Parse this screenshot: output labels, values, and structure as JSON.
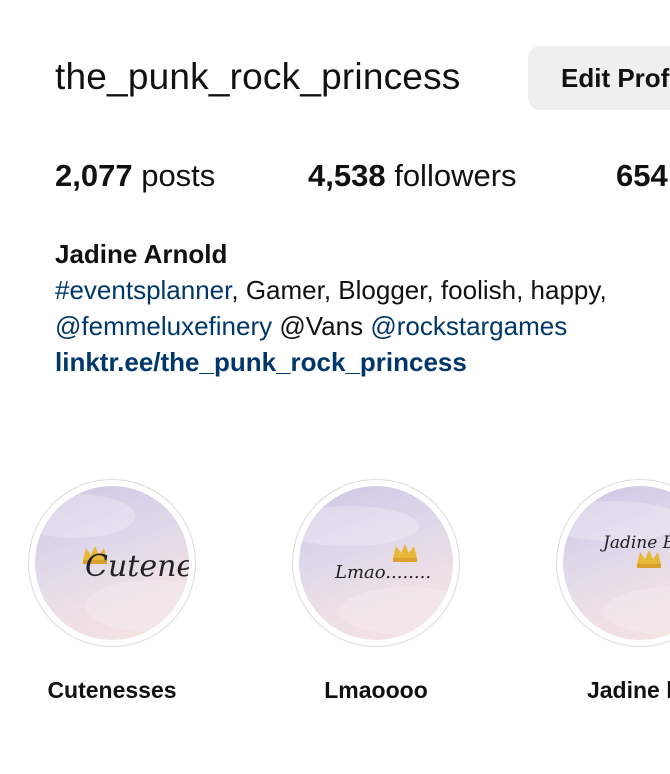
{
  "profile": {
    "username": "the_punk_rock_princess",
    "edit_button": "Edit Profile"
  },
  "stats": {
    "posts_count": "2,077",
    "posts_label": "posts",
    "followers_count": "4,538",
    "followers_label": "followers",
    "following_count": "654"
  },
  "bio": {
    "full_name": "Jadine Arnold",
    "hashtag": "#eventsplanner",
    "line1_text": ", Gamer, Blogger, foolish, happy,",
    "mention1": "@femmeluxefinery",
    "mention2_text": " @Vans ",
    "mention3": "@rockstargames",
    "link": "linktr.ee/the_punk_rock_princess"
  },
  "highlights": [
    {
      "label": "Cutenesses",
      "cover_text": "Cuteness"
    },
    {
      "label": "Lmaoooo",
      "cover_text": "Lmao........"
    },
    {
      "label": "Jadine be",
      "cover_text": "Jadine Being......"
    }
  ],
  "colors": {
    "link_blue": "#00376b",
    "button_bg": "#efefef",
    "crown_gold": "#e7b73a"
  }
}
